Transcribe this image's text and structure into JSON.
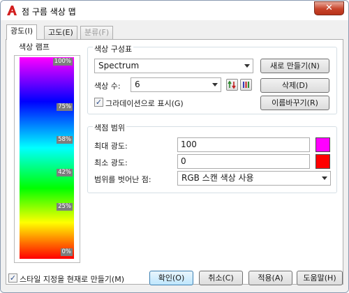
{
  "window": {
    "title": "점 구름 색상 맵",
    "close_label": "✕"
  },
  "tabs": [
    {
      "label": "광도(I)"
    },
    {
      "label": "고도(E)"
    },
    {
      "label": "분류(F)"
    }
  ],
  "color_ramp": {
    "label": "색상 램프",
    "ticks": [
      "100%",
      "75%",
      "58%",
      "42%",
      "25%",
      "0%"
    ]
  },
  "color_scheme": {
    "label": "색상 구성표",
    "scheme_value": "Spectrum",
    "new_button": "새로 만들기(N)",
    "color_count_label": "색상 수:",
    "color_count_value": "6",
    "delete_button": "삭제(D)",
    "gradient_checkbox_label": "그라데이션으로 표시(G)",
    "gradient_checked": true,
    "rename_button": "이름바꾸기(R)"
  },
  "range": {
    "label": "색점 범위",
    "max_label": "최대 광도:",
    "max_value": "100",
    "max_color": "#ff00ff",
    "min_label": "최소 광도:",
    "min_value": "0",
    "min_color": "#ff0000",
    "outside_label": "범위를 벗어난 점:",
    "outside_value": "RGB 스캔 색상 사용"
  },
  "footer": {
    "make_current_label": "스타일 지정을 현재로 만들기(M)",
    "make_current_checked": true,
    "ok": "확인(O)",
    "cancel": "취소(C)",
    "apply": "적용(A)",
    "help": "도움말(H)"
  }
}
